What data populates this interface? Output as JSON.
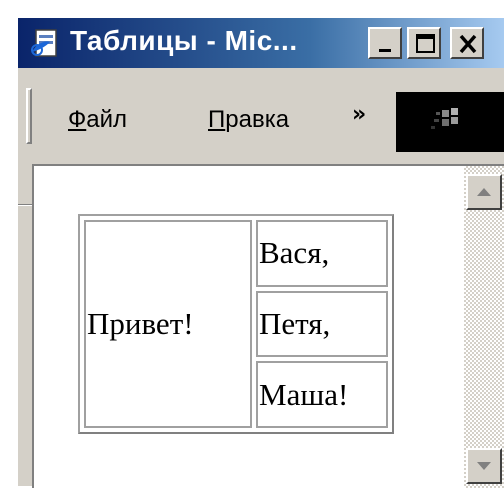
{
  "window": {
    "title": "Таблицы - Mic...",
    "title_bar_colors": [
      "#0a246a",
      "#3a6ea5",
      "#a6caf0"
    ]
  },
  "menu": {
    "items": [
      {
        "accel": "Ф",
        "rest": "айл"
      },
      {
        "accel": "П",
        "rest": "равка"
      }
    ],
    "overflow": "»"
  },
  "content": {
    "table": {
      "merged_cell": "Привет!",
      "cells": [
        "Вася,",
        "Петя,",
        "Маша!"
      ]
    }
  }
}
